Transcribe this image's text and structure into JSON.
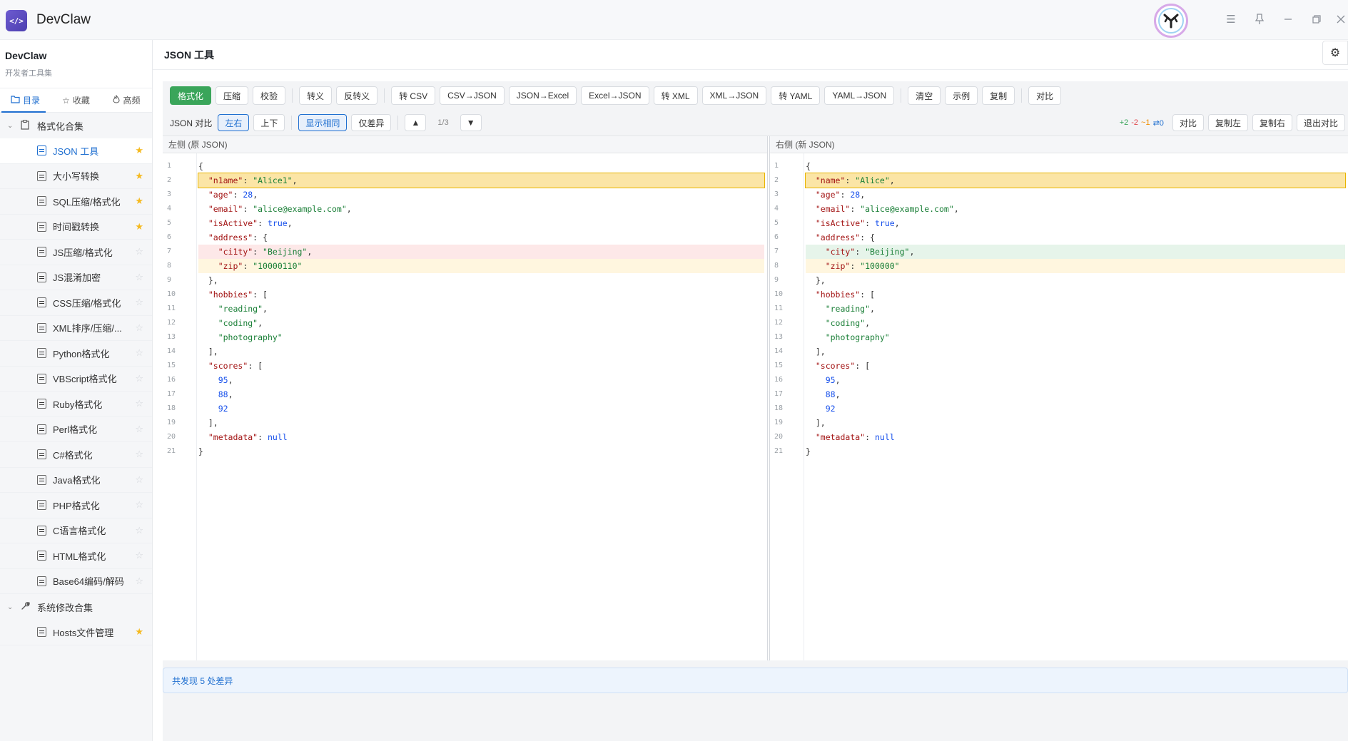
{
  "app": {
    "title": "DevClaw",
    "logo_text": "</>"
  },
  "sidebar": {
    "title": "DevClaw",
    "subtitle": "开发者工具集",
    "tabs": [
      {
        "icon": "folder-icon",
        "label": "目录"
      },
      {
        "icon": "star-icon",
        "label": "收藏"
      },
      {
        "icon": "fire-icon",
        "label": "高频"
      }
    ],
    "groups": [
      {
        "label": "格式化合集",
        "items": [
          {
            "label": "JSON 工具",
            "starred": true,
            "active": true
          },
          {
            "label": "大小写转换",
            "starred": true
          },
          {
            "label": "SQL压缩/格式化",
            "starred": true
          },
          {
            "label": "时间戳转换",
            "starred": true
          },
          {
            "label": "JS压缩/格式化",
            "starred": false
          },
          {
            "label": "JS混淆加密",
            "starred": false
          },
          {
            "label": "CSS压缩/格式化",
            "starred": false
          },
          {
            "label": "XML排序/压缩/...",
            "starred": false
          },
          {
            "label": "Python格式化",
            "starred": false
          },
          {
            "label": "VBScript格式化",
            "starred": false
          },
          {
            "label": "Ruby格式化",
            "starred": false
          },
          {
            "label": "Perl格式化",
            "starred": false
          },
          {
            "label": "C#格式化",
            "starred": false
          },
          {
            "label": "Java格式化",
            "starred": false
          },
          {
            "label": "PHP格式化",
            "starred": false
          },
          {
            "label": "C语言格式化",
            "starred": false
          },
          {
            "label": "HTML格式化",
            "starred": false
          },
          {
            "label": "Base64编码/解码",
            "starred": false
          }
        ]
      },
      {
        "label": "系统修改合集",
        "items": [
          {
            "label": "Hosts文件管理",
            "starred": true
          }
        ]
      }
    ]
  },
  "main": {
    "title": "JSON 工具",
    "toolbar": [
      "格式化",
      "压缩",
      "校验",
      "|",
      "转义",
      "反转义",
      "|",
      "转 CSV",
      "CSV→JSON",
      "JSON→Excel",
      "Excel→JSON",
      "转 XML",
      "XML→JSON",
      "转 YAML",
      "YAML→JSON",
      "|",
      "清空",
      "示例",
      "复制",
      "|",
      "对比"
    ],
    "compare": {
      "label": "JSON 对比",
      "layout_left_right": "左右",
      "layout_top_bottom": "上下",
      "show_same": "显示相同",
      "only_diff": "仅差异",
      "prev": "▲",
      "counter": "1/3",
      "next": "▼",
      "stats": {
        "added": "+2",
        "removed": "-2",
        "changed": "~1",
        "moved": "⇄0"
      },
      "actions": [
        "对比",
        "复制左",
        "复制右",
        "退出对比"
      ]
    },
    "left_pane": {
      "header": "左侧 (原 JSON)",
      "line_numbers": [
        "1",
        "2",
        "3",
        "4",
        "5",
        "6",
        "7",
        "8",
        "9",
        "10",
        "11",
        "12",
        "13",
        "14",
        "15",
        "16",
        "17",
        "18",
        "19",
        "20",
        "21"
      ],
      "lines": [
        "{",
        "  \"n1ame\": \"Alice1\",",
        "  \"age\": 28,",
        "  \"email\": \"alice@example.com\",",
        "  \"isActive\": true,",
        "  \"address\": {",
        "    \"ci1ty\": \"Beijing\",",
        "    \"zip\": \"10000110\"",
        "  },",
        "  \"hobbies\": [",
        "    \"reading\",",
        "    \"coding\",",
        "    \"photography\"",
        "  ],",
        "  \"scores\": [",
        "    95,",
        "    88,",
        "    92",
        "  ],",
        "  \"metadata\": null",
        "}"
      ]
    },
    "right_pane": {
      "header": "右侧 (新 JSON)",
      "line_numbers": [
        "1",
        "2",
        "3",
        "4",
        "5",
        "6",
        "7",
        "8",
        "9",
        "10",
        "11",
        "12",
        "13",
        "14",
        "15",
        "16",
        "17",
        "18",
        "19",
        "20",
        "21"
      ],
      "lines": [
        "{",
        "  \"name\": \"Alice\",",
        "  \"age\": 28,",
        "  \"email\": \"alice@example.com\",",
        "  \"isActive\": true,",
        "  \"address\": {",
        "    \"city\": \"Beijing\",",
        "    \"zip\": \"100000\"",
        "  },",
        "  \"hobbies\": [",
        "    \"reading\",",
        "    \"coding\",",
        "    \"photography\"",
        "  ],",
        "  \"scores\": [",
        "    95,",
        "    88,",
        "    92",
        "  ],",
        "  \"metadata\": null",
        "}"
      ]
    },
    "status": "共发现 5 处差异"
  },
  "colors": {
    "accent": "#1f6fd0",
    "primary_button": "#3aa55a",
    "star": "#f5b91e",
    "diff_modified": "#fbe5a6",
    "diff_removed": "#fde8e8",
    "diff_added": "#e6f4ea"
  }
}
